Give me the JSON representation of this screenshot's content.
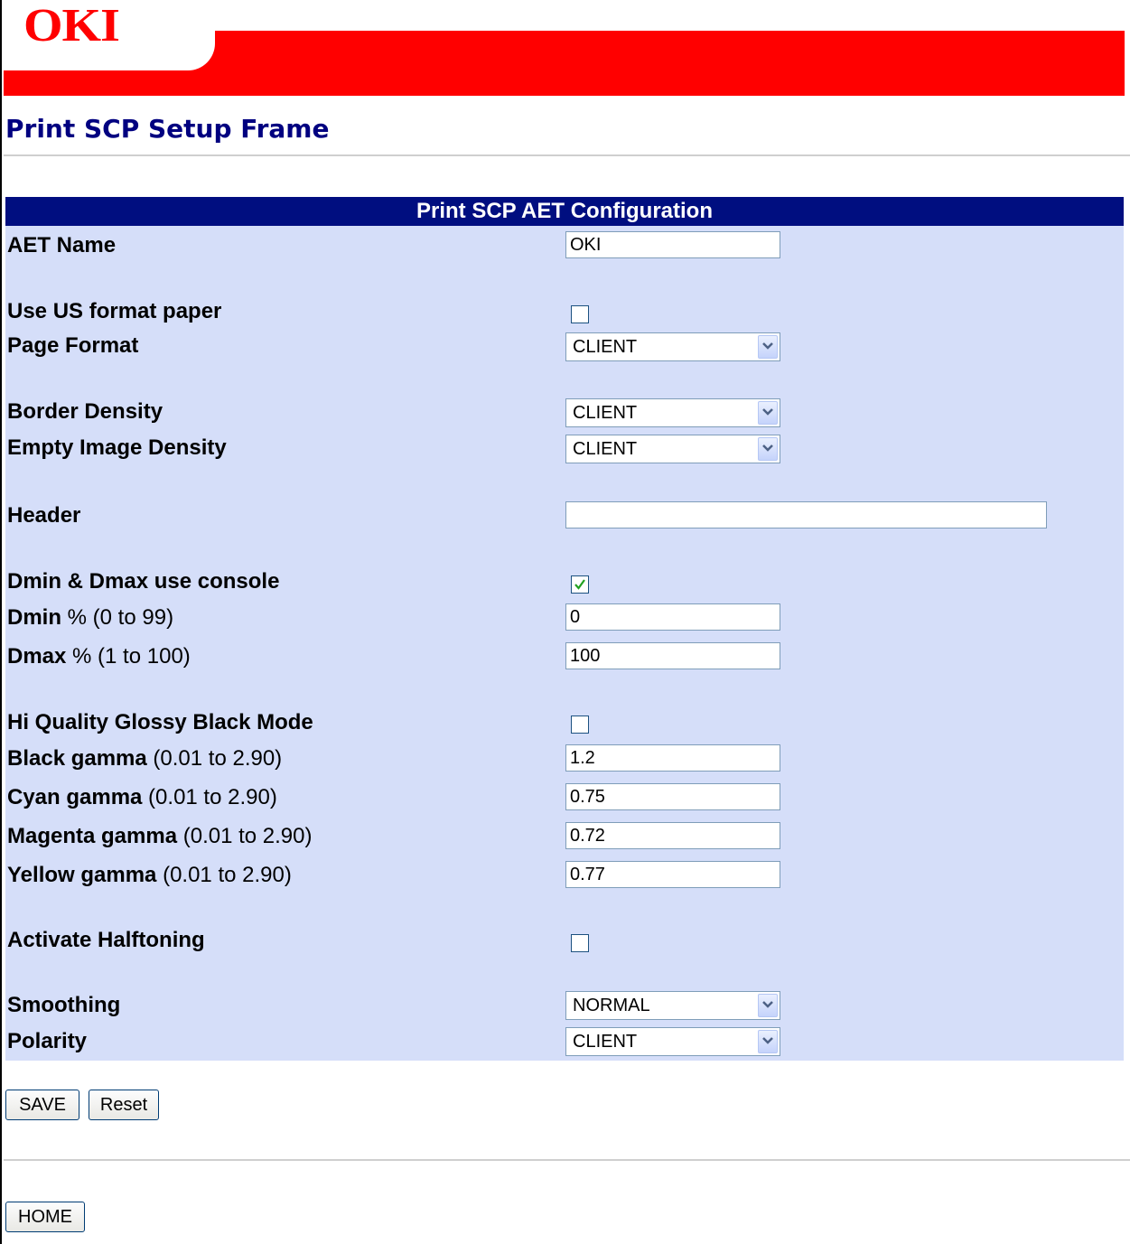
{
  "brand": {
    "logo_text": "OKI",
    "color": "#ff0000"
  },
  "page_title": "Print SCP Setup Frame",
  "panel": {
    "title": "Print SCP AET Configuration",
    "header_color": "#000e80",
    "background": "#d5def9"
  },
  "fields": {
    "aet_name": {
      "label": "AET Name",
      "value": "OKI"
    },
    "us_paper": {
      "label": "Use US format paper",
      "checked": false
    },
    "page_format": {
      "label": "Page Format",
      "value": "CLIENT"
    },
    "border_density": {
      "label": "Border Density",
      "value": "CLIENT"
    },
    "empty_density": {
      "label": "Empty Image Density",
      "value": "CLIENT"
    },
    "header": {
      "label": "Header",
      "value": ""
    },
    "dmin_dmax_console": {
      "label": "Dmin & Dmax use console",
      "checked": true
    },
    "dmin": {
      "label": "Dmin",
      "hint": " % (0 to 99)",
      "value": "0"
    },
    "dmax": {
      "label": "Dmax",
      "hint": " % (1 to 100)",
      "value": "100"
    },
    "glossy_black": {
      "label": "Hi Quality Glossy Black Mode",
      "checked": false
    },
    "black_gamma": {
      "label": "Black gamma",
      "hint": " (0.01 to 2.90)",
      "value": "1.2"
    },
    "cyan_gamma": {
      "label": "Cyan gamma",
      "hint": " (0.01 to 2.90)",
      "value": "0.75"
    },
    "magenta_gamma": {
      "label": "Magenta gamma",
      "hint": " (0.01 to 2.90)",
      "value": "0.72"
    },
    "yellow_gamma": {
      "label": "Yellow gamma",
      "hint": " (0.01 to 2.90)",
      "value": "0.77"
    },
    "halftoning": {
      "label": "Activate Halftoning",
      "checked": false
    },
    "smoothing": {
      "label": "Smoothing",
      "value": "NORMAL"
    },
    "polarity": {
      "label": "Polarity",
      "value": "CLIENT"
    }
  },
  "buttons": {
    "save": "SAVE",
    "reset": "Reset",
    "home": "HOME"
  },
  "icons": {
    "dropdown": "chevron-down-icon",
    "check": "check-icon"
  }
}
